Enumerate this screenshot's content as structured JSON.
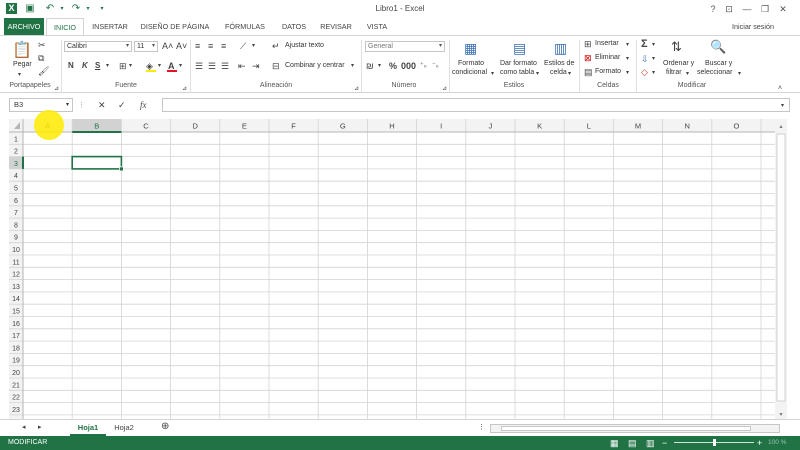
{
  "titlebar": {
    "title": "Libro1 - Excel",
    "help": "?",
    "min": "—",
    "restore": "❐",
    "close": "✕"
  },
  "tabs": [
    {
      "label": "ARCHIVO"
    },
    {
      "label": "INICIO"
    },
    {
      "label": "INSERTAR"
    },
    {
      "label": "DISEÑO DE PÁGINA"
    },
    {
      "label": "FÓRMULAS"
    },
    {
      "label": "DATOS"
    },
    {
      "label": "REVISAR"
    },
    {
      "label": "VISTA"
    }
  ],
  "login": "Iniciar sesión",
  "ribbon": {
    "clipboard": {
      "paste": "Pegar",
      "label": "Portapapeles"
    },
    "font": {
      "name": "Calibri",
      "size": "11",
      "bold": "N",
      "italic": "K",
      "underline": "S",
      "label": "Fuente"
    },
    "alignment": {
      "wrap": "Ajustar texto",
      "merge": "Combinar y centrar",
      "label": "Alineación"
    },
    "number": {
      "format": "General",
      "label": "Número"
    },
    "styles": {
      "conditional_1": "Formato",
      "conditional_2": "condicional",
      "table_1": "Dar formato",
      "table_2": "como tabla",
      "cell_1": "Estilos de",
      "cell_2": "celda",
      "label": "Estilos"
    },
    "cells": {
      "insert": "Insertar",
      "delete": "Eliminar",
      "format": "Formato",
      "label": "Celdas"
    },
    "editing": {
      "sort_1": "Ordenar y",
      "sort_2": "filtrar",
      "find_1": "Buscar y",
      "find_2": "seleccionar",
      "label": "Modificar"
    }
  },
  "formula_bar": {
    "name_box": "B3",
    "value": ""
  },
  "grid": {
    "columns": [
      "A",
      "B",
      "C",
      "D",
      "E",
      "F",
      "G",
      "H",
      "I",
      "J",
      "K",
      "L",
      "M",
      "N",
      "O"
    ],
    "rows": [
      "1",
      "2",
      "3",
      "4",
      "5",
      "6",
      "7",
      "8",
      "9",
      "10",
      "11",
      "12",
      "13",
      "14",
      "15",
      "16",
      "17",
      "18",
      "19",
      "20",
      "21",
      "22",
      "23"
    ],
    "selected_cell": "B3"
  },
  "sheets": [
    {
      "label": "Hoja1",
      "active": true
    },
    {
      "label": "Hoja2",
      "active": false
    }
  ],
  "status": {
    "mode": "MODIFICAR",
    "zoom": "100 %"
  },
  "colors": {
    "accent": "#217346",
    "selection": "#217346",
    "header_bg": "#f3f3f3",
    "grid_line": "#d4d4d4"
  }
}
